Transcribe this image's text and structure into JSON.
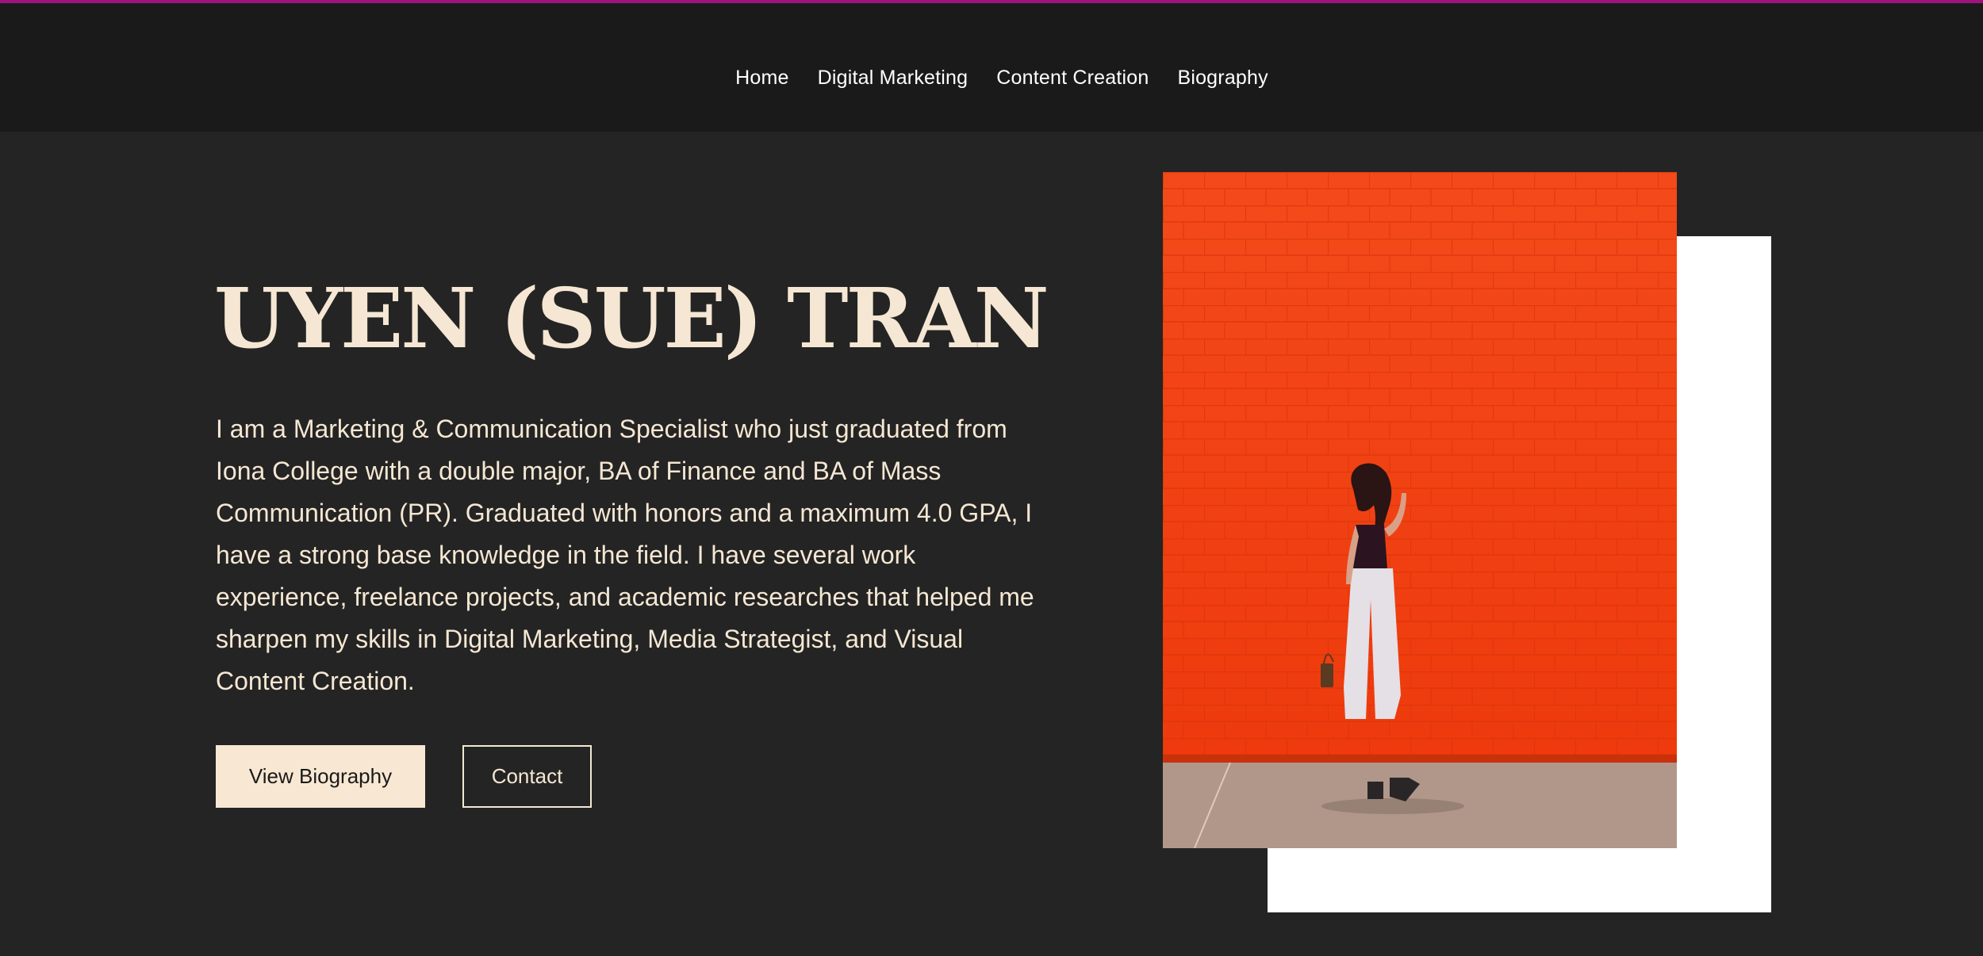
{
  "nav": {
    "items": [
      {
        "label": "Home"
      },
      {
        "label": "Digital Marketing"
      },
      {
        "label": "Content Creation"
      },
      {
        "label": "Biography"
      }
    ]
  },
  "hero": {
    "title": "UYEN (SUE) TRAN",
    "bio": "I am a Marketing & Communication Specialist who just graduated from Iona College with a double major, BA of Finance and BA of Mass Communication (PR). Graduated with honors and a maximum 4.0 GPA, I have a strong base knowledge in the field. I have several work experience, freelance projects, and academic researches that helped me sharpen my skills in Digital Marketing, Media Strategist, and Visual Content Creation.",
    "primary_button": "View Biography",
    "secondary_button": "Contact"
  },
  "colors": {
    "accent": "#a0137f",
    "background": "#242424",
    "header": "#1a1a1a",
    "cream": "#f5e7d3",
    "photo_wall": "#f23d10"
  }
}
